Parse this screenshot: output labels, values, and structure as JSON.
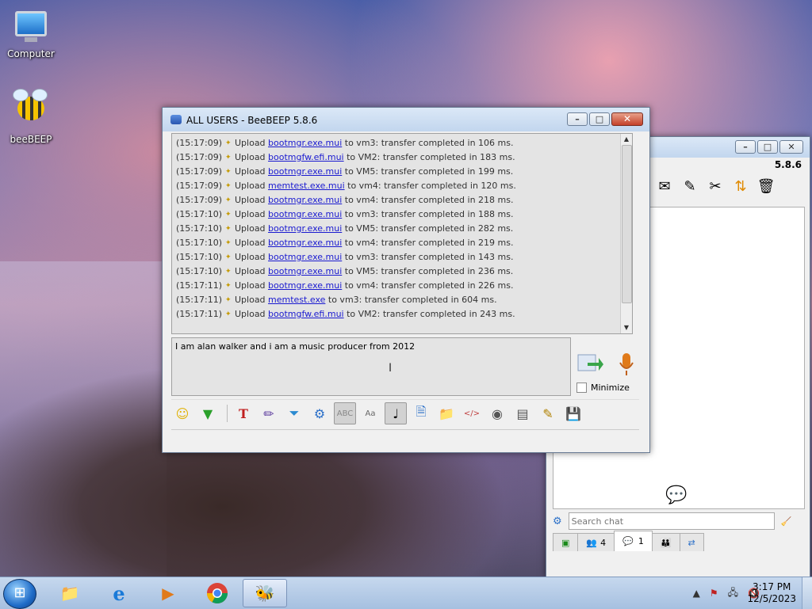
{
  "desktop": {
    "icons": [
      {
        "label": "Computer"
      },
      {
        "label": "beeBEEP"
      }
    ]
  },
  "chat_window": {
    "title": "ALL USERS - BeeBEEP 5.8.6",
    "log": [
      {
        "time": "(15:17:09)",
        "action": "Upload",
        "file": "bootmgr.exe.mui",
        "rest": "to vm3: transfer completed in 106 ms."
      },
      {
        "time": "(15:17:09)",
        "action": "Upload",
        "file": "bootmgfw.efi.mui",
        "rest": "to VM2: transfer completed in 183 ms."
      },
      {
        "time": "(15:17:09)",
        "action": "Upload",
        "file": "bootmgr.exe.mui",
        "rest": "to VM5: transfer completed in 199 ms."
      },
      {
        "time": "(15:17:09)",
        "action": "Upload",
        "file": "memtest.exe.mui",
        "rest": "to vm4: transfer completed in 120 ms."
      },
      {
        "time": "(15:17:09)",
        "action": "Upload",
        "file": "bootmgr.exe.mui",
        "rest": "to vm4: transfer completed in 218 ms."
      },
      {
        "time": "(15:17:10)",
        "action": "Upload",
        "file": "bootmgr.exe.mui",
        "rest": "to vm3: transfer completed in 188 ms."
      },
      {
        "time": "(15:17:10)",
        "action": "Upload",
        "file": "bootmgr.exe.mui",
        "rest": "to VM5: transfer completed in 282 ms."
      },
      {
        "time": "(15:17:10)",
        "action": "Upload",
        "file": "bootmgr.exe.mui",
        "rest": "to vm4: transfer completed in 219 ms."
      },
      {
        "time": "(15:17:10)",
        "action": "Upload",
        "file": "bootmgr.exe.mui",
        "rest": "to vm3: transfer completed in 143 ms."
      },
      {
        "time": "(15:17:10)",
        "action": "Upload",
        "file": "bootmgr.exe.mui",
        "rest": "to VM5: transfer completed in 236 ms."
      },
      {
        "time": "(15:17:11)",
        "action": "Upload",
        "file": "bootmgr.exe.mui",
        "rest": "to vm4: transfer completed in 226 ms."
      },
      {
        "time": "(15:17:11)",
        "action": "Upload",
        "file": "memtest.exe",
        "rest": "to vm3: transfer completed in 604 ms."
      },
      {
        "time": "(15:17:11)",
        "action": "Upload",
        "file": "bootmgfw.efi.mui",
        "rest": "to VM2: transfer completed in 243 ms."
      }
    ],
    "compose_text": "I am alan walker and i am a music producer from 2012",
    "minimize_label": "Minimize"
  },
  "main_window": {
    "version": "5.8.6",
    "search_placeholder": "Search chat",
    "tabs": [
      {
        "label": ""
      },
      {
        "label": "4"
      },
      {
        "label": "1"
      },
      {
        "label": ""
      },
      {
        "label": ""
      }
    ]
  },
  "taskbar": {
    "time": "3:17 PM",
    "date": "12/5/2023"
  }
}
